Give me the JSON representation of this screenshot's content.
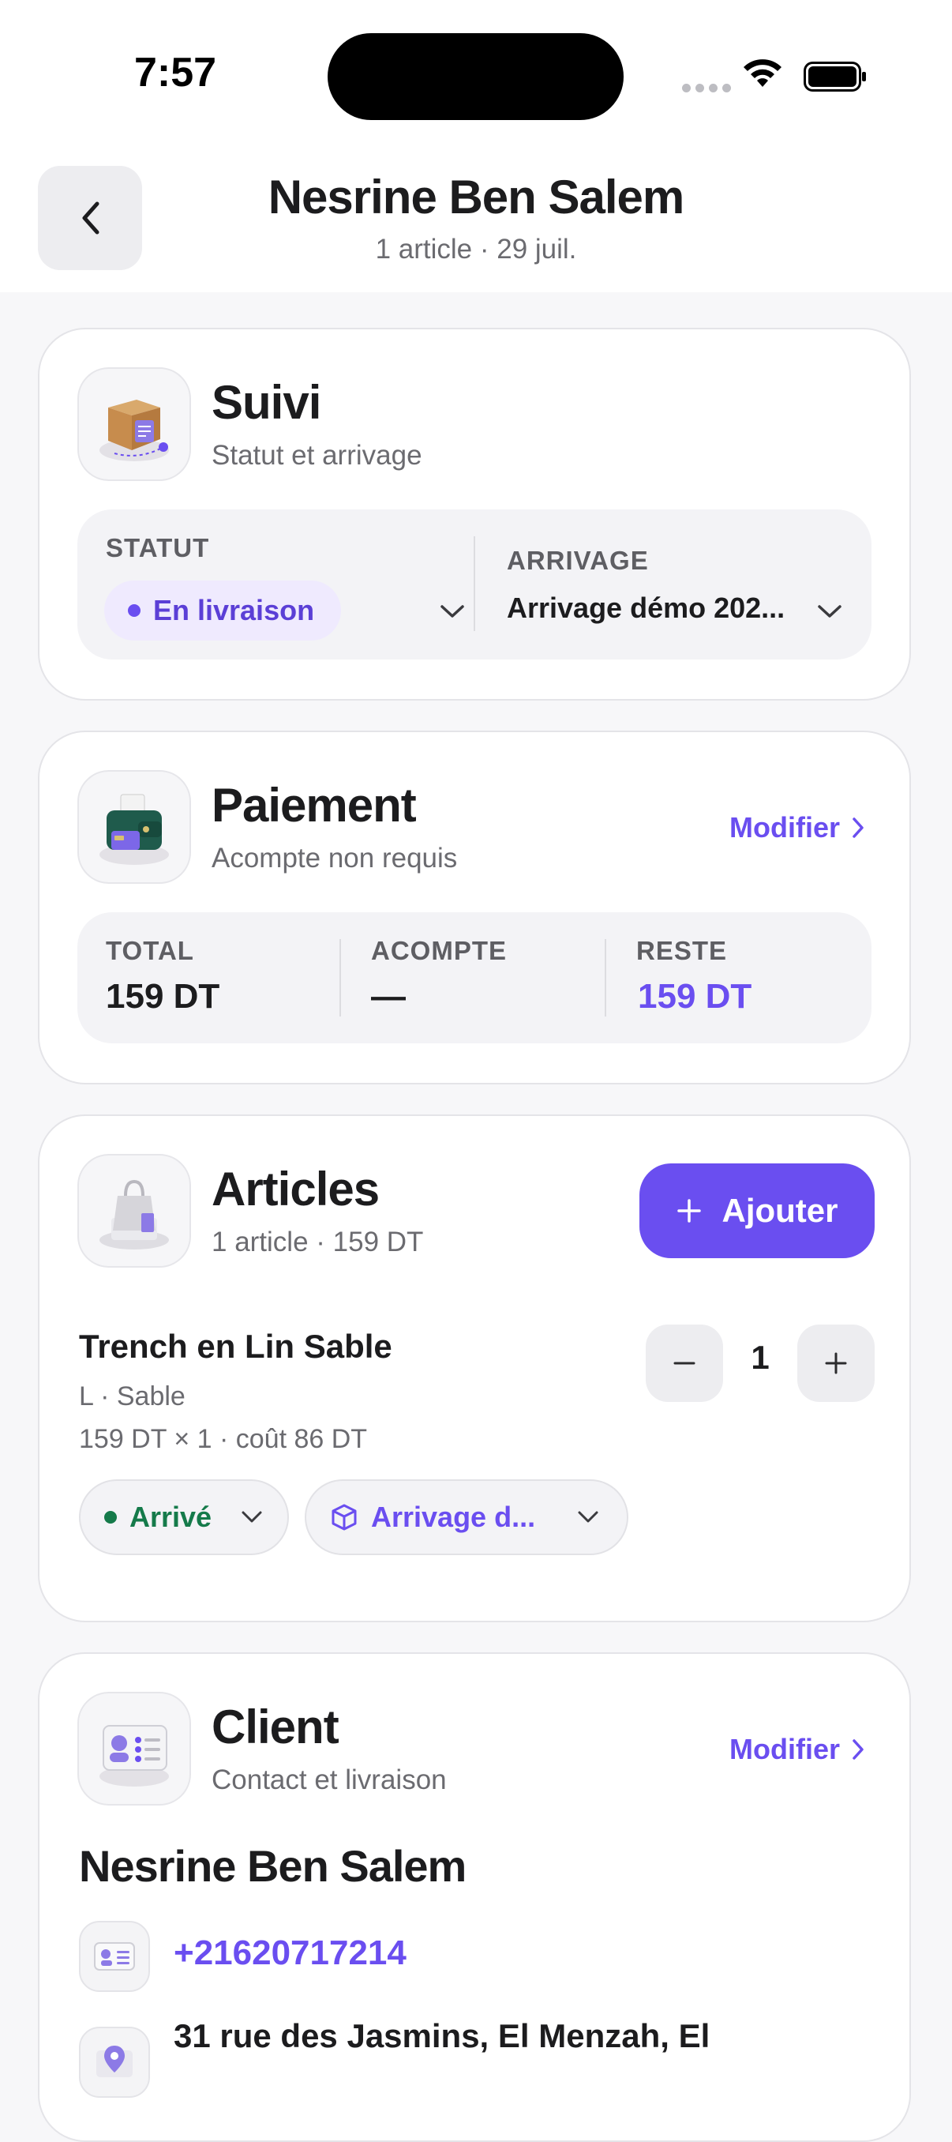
{
  "status_bar": {
    "time": "7:57"
  },
  "header": {
    "title": "Nesrine Ben Salem",
    "subtitle": "1 article · 29 juil."
  },
  "suivi": {
    "title": "Suivi",
    "subtitle": "Statut et arrivage",
    "statut_label": "STATUT",
    "statut_value": "En livraison",
    "arrivage_label": "ARRIVAGE",
    "arrivage_value": "Arrivage démo 202..."
  },
  "paiement": {
    "title": "Paiement",
    "subtitle": "Acompte non requis",
    "modify_label": "Modifier",
    "total_label": "TOTAL",
    "total_value": "159 DT",
    "acompte_label": "ACOMPTE",
    "acompte_value": "—",
    "reste_label": "RESTE",
    "reste_value": "159 DT"
  },
  "articles": {
    "title": "Articles",
    "subtitle": "1 article · 159 DT",
    "add_label": "Ajouter",
    "item": {
      "name": "Trench en Lin Sable",
      "variant": "L · Sable",
      "price_line": "159 DT × 1 · coût 86 DT",
      "quantity": "1",
      "status_label": "Arrivé",
      "arrivage_label": "Arrivage d..."
    }
  },
  "client": {
    "title": "Client",
    "subtitle": "Contact et livraison",
    "modify_label": "Modifier",
    "name": "Nesrine Ben Salem",
    "phone": "+21620717214",
    "address": "31 rue des Jasmins, El Menzah, El"
  },
  "colors": {
    "accent": "#6a4ef0",
    "success": "#157a4a",
    "status_pill_bg": "#efeafe"
  },
  "icons": [
    "chevron-left-icon",
    "box-icon",
    "wallet-icon",
    "shopping-bag-icon",
    "contact-card-icon",
    "chevron-down-icon",
    "chevron-right-icon",
    "plus-icon",
    "minus-icon",
    "cube-icon",
    "wifi-icon",
    "battery-icon"
  ]
}
